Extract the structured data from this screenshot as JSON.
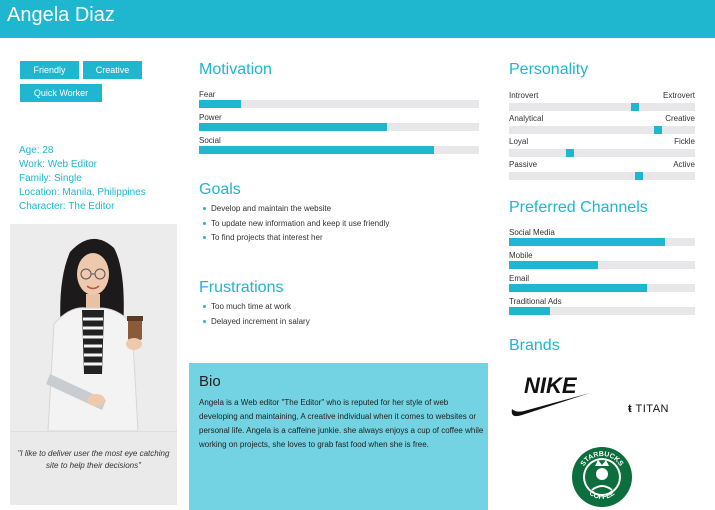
{
  "persona": {
    "name": "Angela Diaz"
  },
  "tags": [
    "Friendly",
    "Creative",
    "Quick Worker"
  ],
  "info": {
    "age": "Age: 28",
    "work": "Work: Web Editor",
    "family": "Family: Single",
    "location": "Location: Manila, Philippines",
    "character": "Character: The Editor"
  },
  "quote": "\"I like to deliver user the most eye catching site to help their decisions\"",
  "motivation": {
    "title": "Motivation",
    "items": [
      {
        "label": "Fear",
        "value": 0.15
      },
      {
        "label": "Power",
        "value": 0.67
      },
      {
        "label": "Social",
        "value": 0.84
      }
    ]
  },
  "goals": {
    "title": "Goals",
    "items": [
      "Develop and maintain the website",
      "To update new information and keep it use friendly",
      "To find projects that interest her"
    ]
  },
  "frustrations": {
    "title": "Frustrations",
    "items": [
      "Too much time at work",
      "Delayed increment in salary"
    ]
  },
  "bio": {
    "title": "Bio",
    "text": "Angela is a Web editor \"The Editor\" who is reputed for her style of web developing and maintaining, A creative individual when it comes to websites or personal life. Angela is a caffeine junkie. she always enjoys a cup of coffee while working on projects, she loves to grab fast food when she is free."
  },
  "personality": {
    "title": "Personality",
    "items": [
      {
        "left": "Introvert",
        "right": "Extrovert",
        "value": 0.68
      },
      {
        "left": "Analytical",
        "right": "Creative",
        "value": 0.8
      },
      {
        "left": "Loyal",
        "right": "Fickle",
        "value": 0.33
      },
      {
        "left": "Passive",
        "right": "Active",
        "value": 0.7
      }
    ]
  },
  "channels": {
    "title": "Preferred Channels",
    "items": [
      {
        "label": "Social Media",
        "value": 0.84
      },
      {
        "label": "Mobile",
        "value": 0.48
      },
      {
        "label": "Email",
        "value": 0.74
      },
      {
        "label": "Traditional Ads",
        "value": 0.22
      }
    ]
  },
  "brands": {
    "title": "Brands",
    "nike": "NIKE",
    "titan": "TITAN",
    "starbucks_top": "STARBUCKS",
    "starbucks_bottom": "COFFEE"
  },
  "colors": {
    "accent": "#1fb6cf",
    "bio_bg": "#74d3e2",
    "track": "#e7e7ea"
  },
  "icons": [
    "nike-swoosh-logo",
    "titan-logo",
    "starbucks-logo",
    "persona-photo"
  ]
}
